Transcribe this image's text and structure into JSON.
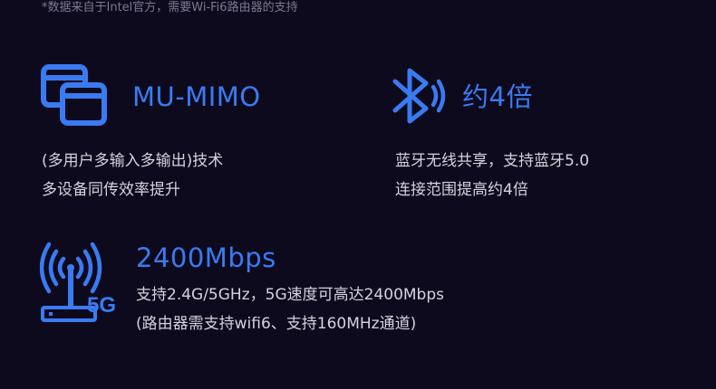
{
  "note": "*数据来自于Intel官方，需要Wi-Fi6路由器的支持",
  "features": [
    {
      "icon": "mu-mimo-windows-icon",
      "title": "MU-MIMO",
      "lines": [
        "(多用户多输入多输出)技术",
        "多设备同传效率提升"
      ]
    },
    {
      "icon": "bluetooth-icon",
      "title": "约4倍",
      "lines": [
        "蓝牙无线共享，支持蓝牙5.0",
        "连接范围提高约4倍"
      ]
    },
    {
      "icon": "wifi-5g-router-icon",
      "icon_label": "5G",
      "title": "2400Mbps",
      "lines": [
        "支持2.4G/5GHz，5G速度可高达2400Mbps",
        "(路由器需支持wifi6、支持160MHz通道)"
      ]
    }
  ],
  "colors": {
    "background": "#0e0a1e",
    "accent": "#3a7bf2",
    "text": "#d4d3dc",
    "note": "#7b7890"
  }
}
